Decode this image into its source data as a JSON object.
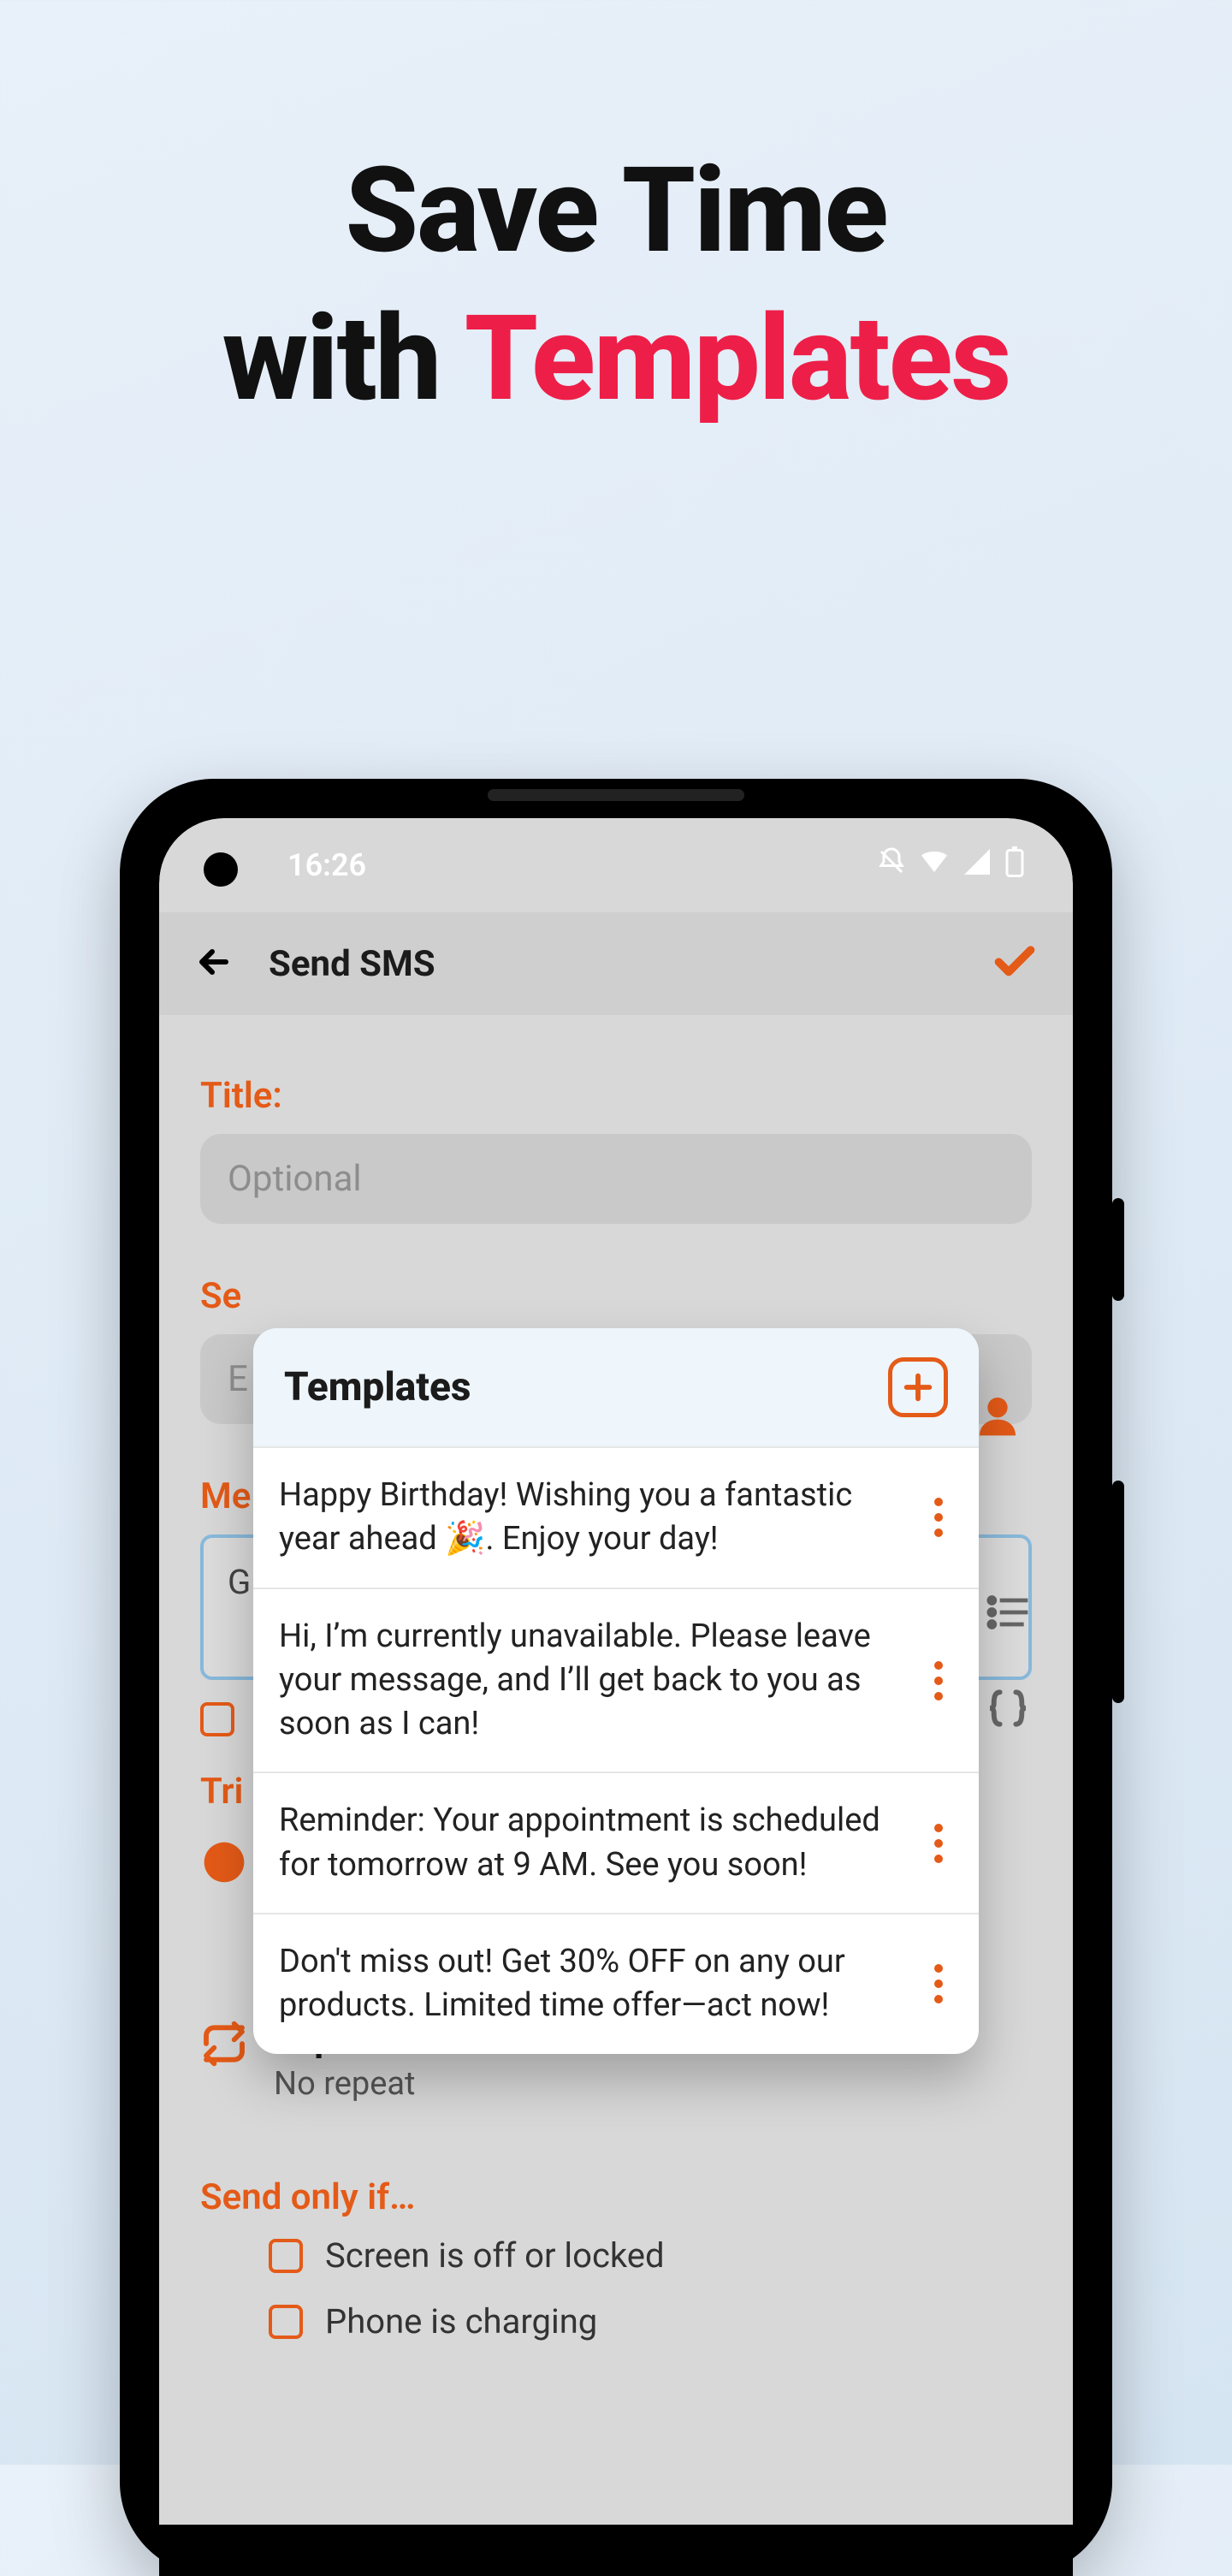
{
  "hero": {
    "line1": "Save Time",
    "line2_prefix": "with ",
    "line2_accent": "Templates"
  },
  "status": {
    "time": "16:26"
  },
  "appbar": {
    "title": "Send SMS"
  },
  "form": {
    "title_label": "Title:",
    "title_placeholder": "Optional",
    "send_to_label_partial": "Se",
    "send_to_value_partial": "E",
    "message_label_partial": "Me",
    "message_value_partial": "G",
    "trigger_label_partial": "Tri",
    "repeat_label": "Repeat",
    "repeat_value": "No repeat",
    "send_only_if_label": "Send only if…",
    "cond_screen": "Screen is off or locked",
    "cond_charging": "Phone is charging"
  },
  "popup": {
    "title": "Templates",
    "items": [
      "Happy Birthday! Wishing you a fantastic year ahead 🎉. Enjoy your day!",
      "Hi, I’m currently unavailable. Please leave your message, and I’ll get back to you as soon as I can!",
      "Reminder: Your appointment is scheduled for tomorrow at 9 AM. See you soon!",
      "Don't miss out! Get 30% OFF on any our products. Limited time offer—act now!"
    ]
  },
  "colors": {
    "accent": "#e45a17",
    "hero_accent": "#ed1f48"
  }
}
